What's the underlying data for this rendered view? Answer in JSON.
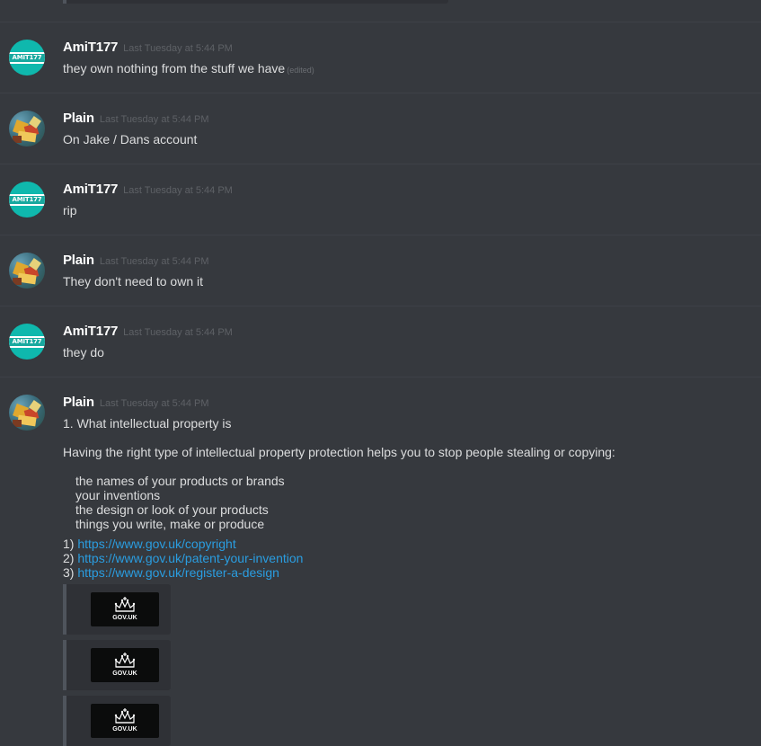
{
  "users": {
    "amit": {
      "name": "AmiT177",
      "avatar_text": "AMIT177"
    },
    "plain": {
      "name": "Plain"
    }
  },
  "messages": [
    {
      "author": "AmiT177",
      "timestamp": "Last Tuesday at 5:44 PM",
      "text": "they own nothing from the stuff we have",
      "edited_label": "(edited)"
    },
    {
      "author": "Plain",
      "timestamp": "Last Tuesday at 5:44 PM",
      "text": "On Jake / Dans account"
    },
    {
      "author": "AmiT177",
      "timestamp": "Last Tuesday at 5:44 PM",
      "text": "rip"
    },
    {
      "author": "Plain",
      "timestamp": "Last Tuesday at 5:44 PM",
      "text": "They don't need to own it"
    },
    {
      "author": "AmiT177",
      "timestamp": "Last Tuesday at 5:44 PM",
      "text": "they do"
    },
    {
      "author": "Plain",
      "timestamp": "Last Tuesday at 5:44 PM",
      "heading": "1. What intellectual property is",
      "intro": "Having the right type of intellectual property protection helps you to stop people stealing or copying:",
      "list": [
        "the names of your products or brands",
        "your inventions",
        "the design or look of your products",
        "things you write, make or produce"
      ],
      "links": [
        {
          "prefix": "1) ",
          "url": "https://www.gov.uk/copyright"
        },
        {
          "prefix": "2) ",
          "url": "https://www.gov.uk/patent-your-invention"
        },
        {
          "prefix": "3) ",
          "url": "https://www.gov.uk/register-a-design"
        }
      ],
      "embeds": [
        {
          "logo_text": "GOV.UK",
          "icon": "crown-icon"
        },
        {
          "logo_text": "GOV.UK",
          "icon": "crown-icon"
        },
        {
          "logo_text": "GOV.UK",
          "icon": "crown-icon"
        }
      ]
    }
  ],
  "colors": {
    "background": "#36393e",
    "username": "#ffffff",
    "timestamp": "#5e6166",
    "message_text": "#dcddde",
    "link": "#2a9de0",
    "amit_avatar": "#0fb8ad"
  }
}
